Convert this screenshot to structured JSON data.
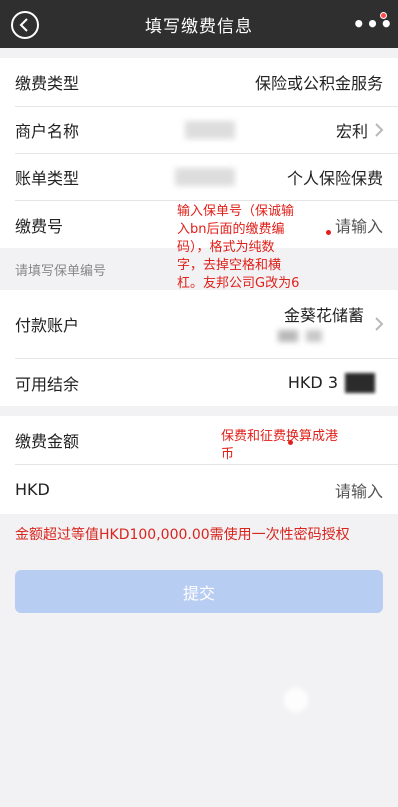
{
  "nav": {
    "title": "填写缴费信息",
    "back_icon": "chevron-left-icon",
    "more_icon": "ellipsis-icon",
    "more_label": "•••"
  },
  "fields": {
    "payment_type": {
      "label": "缴费类型",
      "value": "保险或公积金服务"
    },
    "merchant_name": {
      "label": "商户名称",
      "value": "宏利"
    },
    "bill_type": {
      "label": "账单类型",
      "value": "个人保险保费"
    },
    "payment_number": {
      "label": "缴费号",
      "placeholder": "请输入"
    },
    "payment_account": {
      "label": "付款账户",
      "value": "金葵花储蓄"
    },
    "available_balance": {
      "label": "可用结余",
      "value": "HKD 3"
    },
    "payment_amount": {
      "label": "缴费金额"
    },
    "currency": {
      "label": "HKD",
      "placeholder": "请输入"
    }
  },
  "hint": "请填写保单编号",
  "annotations": {
    "policy_number_note": [
      "输入保单号（保诚输",
      "入bn后面的缴费编",
      "码），格式为纯数",
      "字，去掉空格和横",
      "杠。友邦公司G改为6"
    ],
    "amount_note": [
      "保费和征费换算成港",
      "币"
    ]
  },
  "warning": "金额超过等值HKD100,000.00需使用一次性密码授权",
  "submit_label": "提交",
  "colors": {
    "nav_bg": "#2f2f2f",
    "page_bg": "#f2f2f4",
    "annotation_red": "#e0201a",
    "warning_red": "#d8261e",
    "submit_bg": "#b8cdf2"
  }
}
